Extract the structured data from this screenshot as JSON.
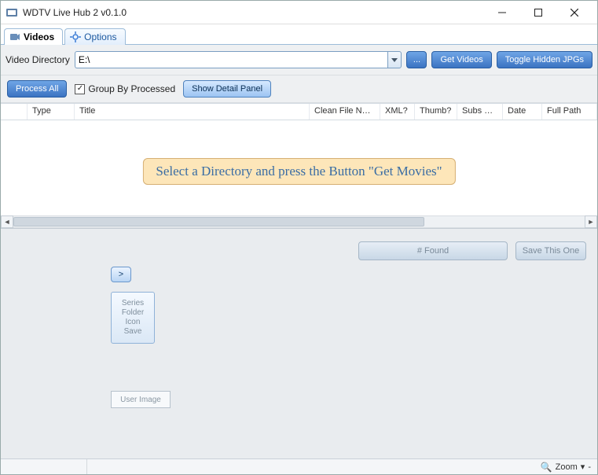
{
  "window": {
    "title": "WDTV Live Hub 2 v0.1.0"
  },
  "tabs": {
    "videos": {
      "label": "Videos"
    },
    "options": {
      "label": "Options"
    }
  },
  "dir": {
    "label": "Video Directory",
    "value": "E:\\",
    "browse": "...",
    "get_videos": "Get Videos",
    "toggle_hidden": "Toggle Hidden JPGs"
  },
  "toolbar": {
    "process_all": "Process All",
    "group_by": "Group By Processed",
    "group_by_checked": "✓",
    "show_detail": "Show Detail Panel"
  },
  "grid": {
    "cols": {
      "blank": "",
      "type": "Type",
      "title": "Title",
      "clean": "Clean File Name",
      "xml": "XML?",
      "thumb": "Thumb?",
      "subs": "Subs Pr...",
      "date": "Date",
      "path": "Full Path"
    },
    "placeholder": "Select a Directory and press the Button \"Get Movies\""
  },
  "detail": {
    "found": "# Found",
    "save_one": "Save This One",
    "nav": ">",
    "series_box": "Series\nFolder\nIcon\nSave",
    "user_image": "User Image"
  },
  "status": {
    "zoom_label": "Zoom",
    "zoom_caret": "▾",
    "zoom_dash": "-"
  }
}
